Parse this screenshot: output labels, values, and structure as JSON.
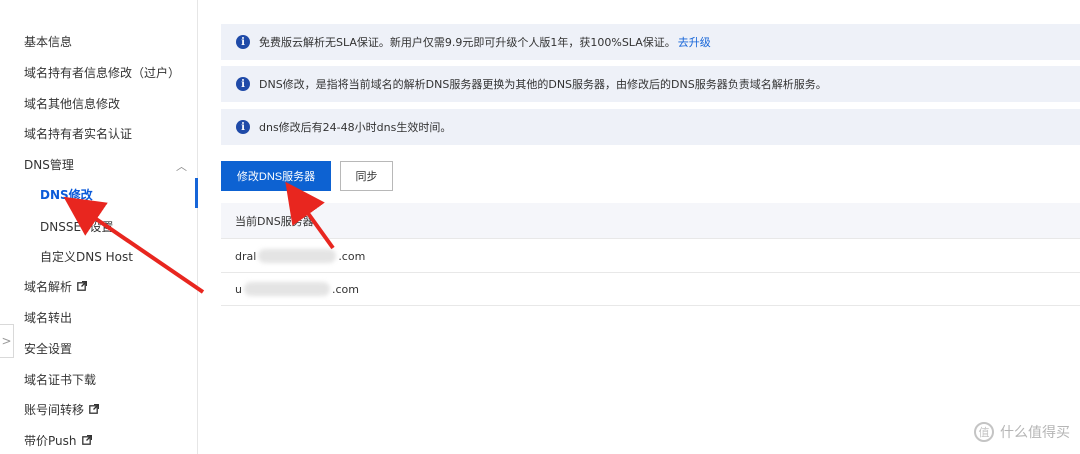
{
  "sidebar": {
    "items": [
      {
        "label": "基本信息"
      },
      {
        "label": "域名持有者信息修改（过户）"
      },
      {
        "label": "域名其他信息修改"
      },
      {
        "label": "域名持有者实名认证"
      },
      {
        "label": "DNS管理"
      },
      {
        "label": "DNS修改"
      },
      {
        "label": "DNSSEC设置"
      },
      {
        "label": "自定义DNS Host"
      },
      {
        "label": "域名解析"
      },
      {
        "label": "域名转出"
      },
      {
        "label": "安全设置"
      },
      {
        "label": "域名证书下载"
      },
      {
        "label": "账号间转移"
      },
      {
        "label": "带价Push"
      }
    ],
    "active_item": "DNS修改",
    "collapse_glyph": ">"
  },
  "notices": [
    {
      "text": "免费版云解析无SLA保证。新用户仅需9.9元即可升级个人版1年，获100%SLA保证。",
      "link": "去升级"
    },
    {
      "text": "DNS修改，是指将当前域名的解析DNS服务器更换为其他的DNS服务器，由修改后的DNS服务器负责域名解析服务。"
    },
    {
      "text": "dns修改后有24-48小时dns生效时间。"
    }
  ],
  "buttons": {
    "modify_dns": "修改DNS服务器",
    "sync": "同步"
  },
  "table": {
    "header": "当前DNS服务器",
    "rows": [
      {
        "prefix": "dral",
        "suffix": ".com"
      },
      {
        "prefix": "u",
        "suffix": ".com"
      }
    ]
  },
  "watermark": {
    "text": "什么值得买",
    "icon_glyph": "值"
  },
  "colors": {
    "primary": "#0d62d2",
    "link": "#1665d8",
    "notice_bg": "#eef1f8",
    "annotation_arrow": "#e8261f"
  }
}
